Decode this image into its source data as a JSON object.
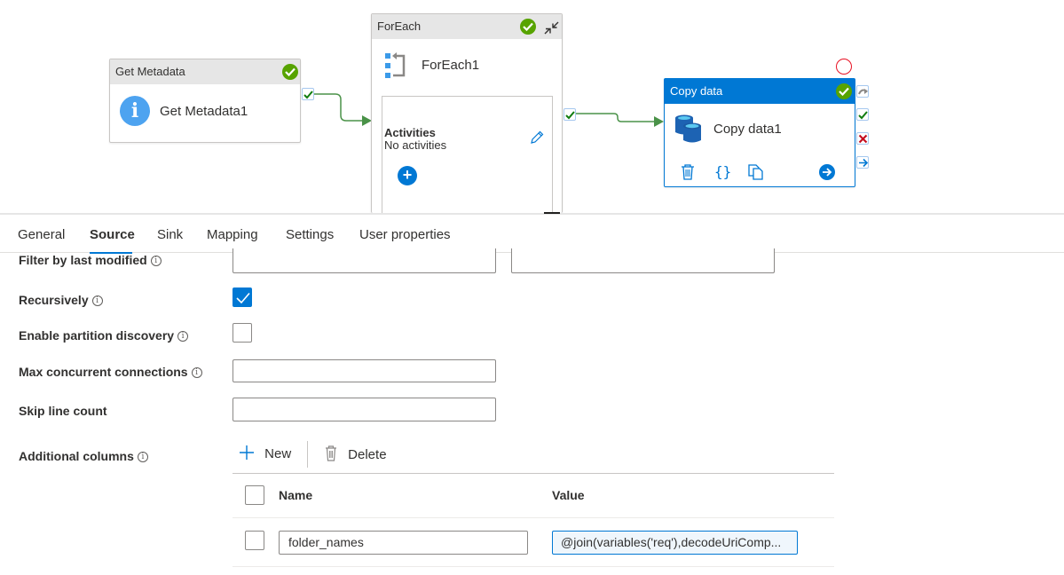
{
  "canvas": {
    "nodes": {
      "get_metadata": {
        "type_label": "Get Metadata",
        "name": "Get Metadata1",
        "status": "succeeded",
        "icon": "info-icon"
      },
      "foreach": {
        "type_label": "ForEach",
        "name": "ForEach1",
        "status": "succeeded",
        "icon": "foreach-icon",
        "activities_title": "Activities",
        "activities_sub": "No activities",
        "add_icon": "plus-icon",
        "edit_icon": "pencil-icon",
        "collapse_icon": "collapse-icon"
      },
      "copy_data": {
        "type_label": "Copy data",
        "name": "Copy data1",
        "status": "succeeded",
        "icon": "database-icon",
        "actions": [
          "delete-icon",
          "code-braces-icon",
          "clone-icon",
          "go-arrow-icon"
        ],
        "side_ports": [
          "skip-icon",
          "success-icon",
          "failure-icon",
          "completion-icon"
        ]
      }
    },
    "colors": {
      "success": "#57a300",
      "accent": "#0078d4",
      "edge": "#4a9248",
      "failure": "#c50f1f"
    }
  },
  "tabs": [
    {
      "label": "General",
      "active": false
    },
    {
      "label": "Source",
      "active": true
    },
    {
      "label": "Sink",
      "active": false
    },
    {
      "label": "Mapping",
      "active": false
    },
    {
      "label": "Settings",
      "active": false
    },
    {
      "label": "User properties",
      "active": false
    }
  ],
  "form": {
    "filter_by_last_modified": {
      "label": "Filter by last modified",
      "start": "",
      "end": ""
    },
    "recursively": {
      "label": "Recursively",
      "checked": true
    },
    "enable_partition_discovery": {
      "label": "Enable partition discovery",
      "checked": false
    },
    "max_concurrent_connections": {
      "label": "Max concurrent connections",
      "value": ""
    },
    "skip_line_count": {
      "label": "Skip line count",
      "value": ""
    },
    "additional_columns": {
      "label": "Additional columns",
      "new_label": "New",
      "delete_label": "Delete",
      "columns": [
        "Name",
        "Value"
      ],
      "rows": [
        {
          "name": "folder_names",
          "value": "@join(variables('req'),decodeUriComp..."
        }
      ]
    }
  }
}
